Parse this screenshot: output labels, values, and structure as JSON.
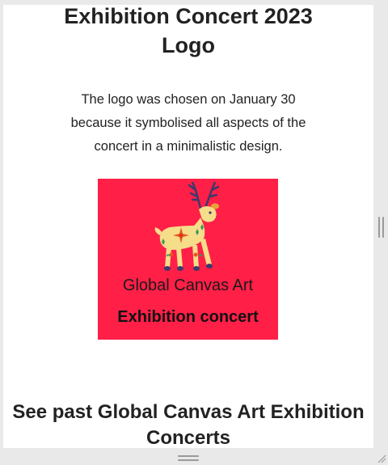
{
  "header": {
    "title_line1": "Exhibition Concert 2023",
    "title_line2": "Logo"
  },
  "description": {
    "line1": "The logo was chosen on January 30",
    "line2": "because it symbolised all aspects of the",
    "line3": "concert in a minimalistic design."
  },
  "logo": {
    "line1": "Global Canvas Art",
    "line2": "Exhibition concert",
    "background": "#ff1f47"
  },
  "section": {
    "heading_line1": "See past Global Canvas Art Exhibition",
    "heading_line2": "Concerts"
  }
}
